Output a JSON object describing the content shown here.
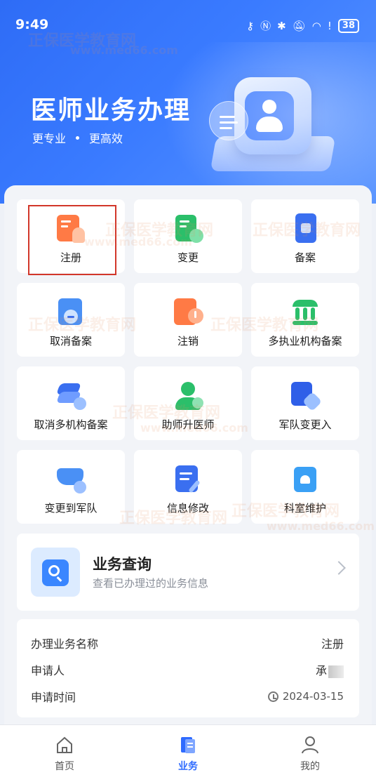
{
  "status_bar": {
    "time": "9:49",
    "battery": "38"
  },
  "hero": {
    "title": "医师业务办理",
    "subtitle_1": "更专业",
    "subtitle_2": "更高效"
  },
  "services": [
    {
      "label": "注册",
      "icon": "register-icon"
    },
    {
      "label": "变更",
      "icon": "change-icon"
    },
    {
      "label": "备案",
      "icon": "filing-icon"
    },
    {
      "label": "取消备案",
      "icon": "cancel-filing-icon"
    },
    {
      "label": "注销",
      "icon": "deregister-icon"
    },
    {
      "label": "多执业机构备案",
      "icon": "multi-institution-filing-icon"
    },
    {
      "label": "取消多机构备案",
      "icon": "cancel-multi-filing-icon"
    },
    {
      "label": "助师升医师",
      "icon": "assistant-upgrade-icon"
    },
    {
      "label": "军队变更入",
      "icon": "military-transfer-in-icon"
    },
    {
      "label": "变更到军队",
      "icon": "change-to-military-icon"
    },
    {
      "label": "信息修改",
      "icon": "info-edit-icon"
    },
    {
      "label": "科室维护",
      "icon": "department-maintenance-icon"
    }
  ],
  "query": {
    "title": "业务查询",
    "description": "查看已办理过的业务信息"
  },
  "record": {
    "name_label": "办理业务名称",
    "name_value": "注册",
    "applicant_label": "申请人",
    "applicant_value": "承",
    "time_label": "申请时间",
    "time_value": "2024-03-15"
  },
  "tabs": [
    {
      "label": "首页",
      "icon": "home-icon"
    },
    {
      "label": "业务",
      "icon": "business-icon",
      "active": true
    },
    {
      "label": "我的",
      "icon": "profile-icon"
    }
  ],
  "watermark": {
    "text_1": "正保医学教育网",
    "text_2": "www.med66.com"
  },
  "colors": {
    "primary": "#2f6bff",
    "orange": "#ff7a45",
    "green": "#2bbf6a",
    "blue": "#3a86ff",
    "highlight": "#d2362a"
  }
}
